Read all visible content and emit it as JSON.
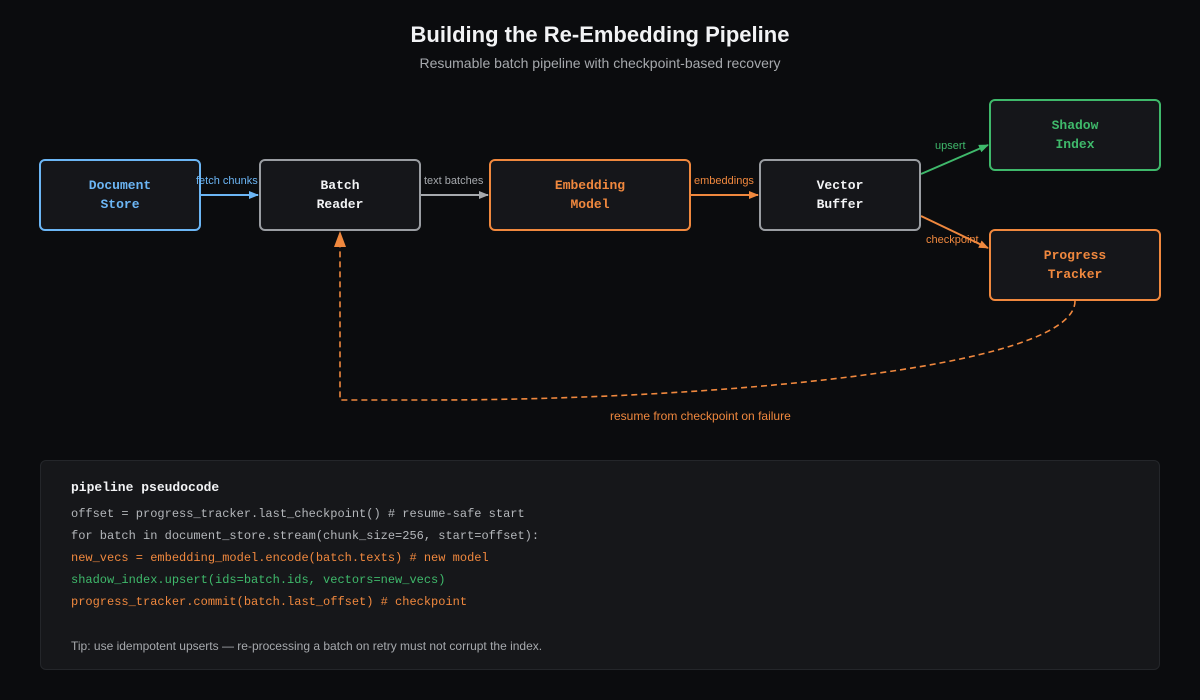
{
  "header": {
    "title": "Building the Re-Embedding Pipeline",
    "subtitle": "Resumable batch pipeline with checkpoint-based recovery"
  },
  "nodes": {
    "document_store": {
      "label": "Document\nStore",
      "color": "#6cb6f5"
    },
    "batch_reader": {
      "label": "Batch\nReader",
      "color": "#f2f3f5"
    },
    "embedding_model": {
      "label": "Embedding\nModel",
      "color": "#f0883e"
    },
    "vector_buffer": {
      "label": "Vector\nBuffer",
      "color": "#f2f3f5"
    },
    "shadow_index": {
      "label": "Shadow\nIndex",
      "color": "#3fb96b"
    },
    "progress_tracker": {
      "label": "Progress\nTracker",
      "color": "#f0883e"
    }
  },
  "edges": {
    "fetch_chunks": "fetch chunks",
    "text_batches": "text batches",
    "embeddings": "embeddings",
    "upsert": "upsert",
    "checkpoint": "checkpoint",
    "resume": "resume from checkpoint on failure"
  },
  "code": {
    "title": "pipeline pseudocode",
    "lines": [
      {
        "text": "offset = progress_tracker.last_checkpoint() # resume-safe start",
        "color": "#b4b7bb"
      },
      {
        "text": "for batch in document_store.stream(chunk_size=256, start=offset):",
        "color": "#b4b7bb"
      },
      {
        "text": "new_vecs = embedding_model.encode(batch.texts) # new model",
        "color": "#f0883e"
      },
      {
        "text": "shadow_index.upsert(ids=batch.ids, vectors=new_vecs)",
        "color": "#3fb96b"
      },
      {
        "text": "progress_tracker.commit(batch.last_offset) # checkpoint",
        "color": "#f0883e"
      }
    ],
    "tip": "Tip: use idempotent upserts — re-processing a batch on retry must not corrupt the index."
  }
}
